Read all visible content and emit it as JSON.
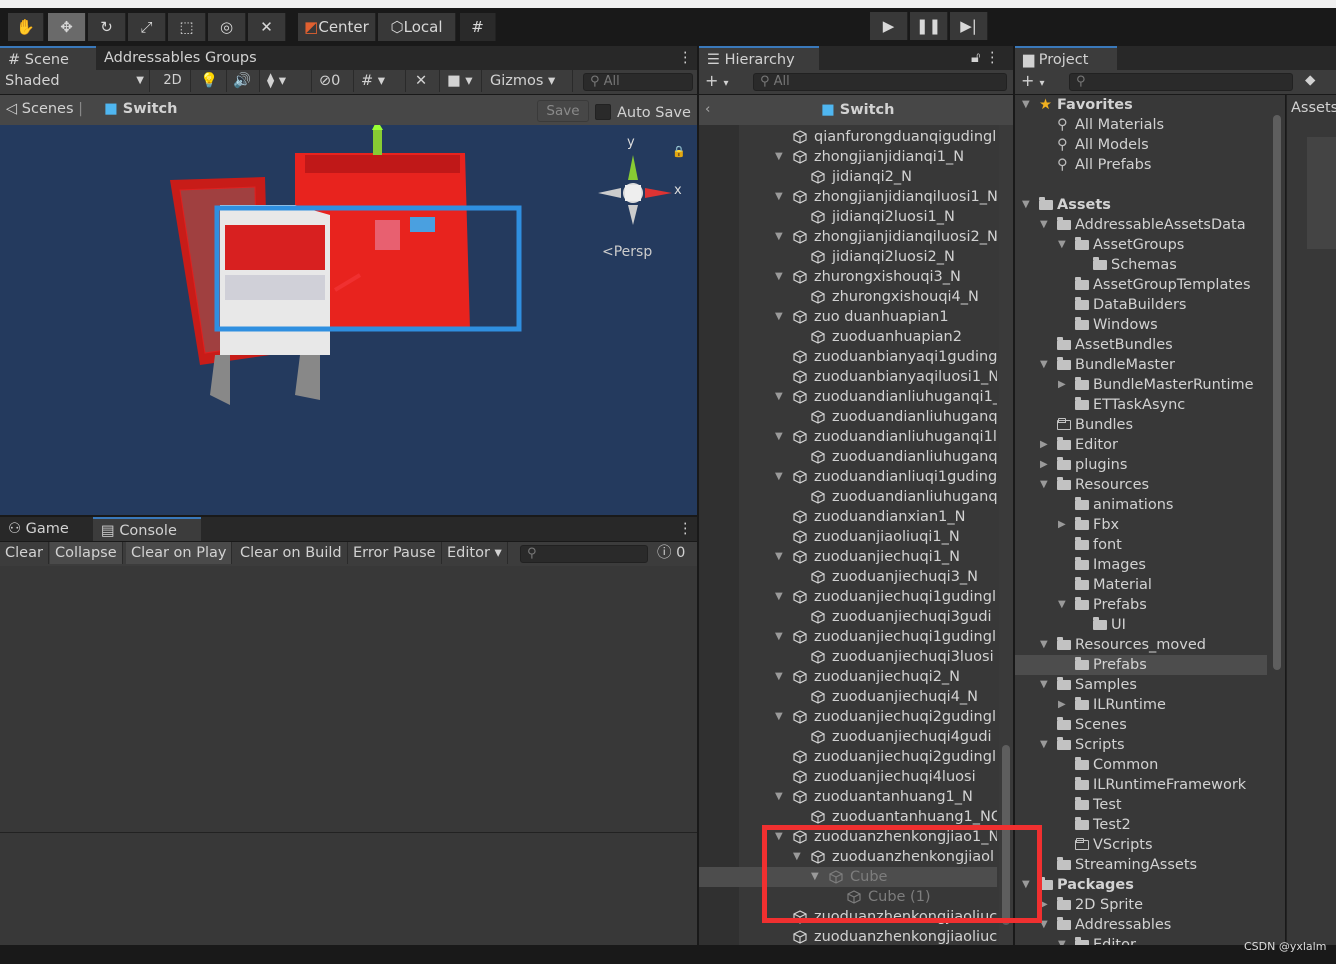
{
  "toolbar": {
    "center_label": "Center",
    "local_label": "Local",
    "tools": [
      "hand-tool",
      "move-tool",
      "rotate-tool",
      "scale-tool",
      "rect-tool",
      "transform-tool",
      "custom-tool"
    ]
  },
  "scene_panel": {
    "tabs": [
      "Scene",
      "Addressables Groups"
    ],
    "shading": "Shaded",
    "mode_2d": "2D",
    "hidden_count": "0",
    "gizmos": "Gizmos",
    "search_placeholder": "All",
    "breadcrumb_scenes": "Scenes",
    "breadcrumb_scene": "Switch",
    "save": "Save",
    "auto_save": "Auto Save",
    "persp": "Persp",
    "axis_y": "y",
    "axis_x": "x"
  },
  "console_panel": {
    "tabs": [
      "Game",
      "Console"
    ],
    "buttons": [
      "Clear",
      "Collapse",
      "Clear on Play",
      "Clear on Build",
      "Error Pause",
      "Editor"
    ],
    "error_count": "0"
  },
  "hierarchy": {
    "title": "Hierarchy",
    "search_placeholder": "All",
    "scene": "Switch",
    "items": [
      {
        "n": "qianfurongduanqigudingl",
        "l": 0,
        "a": ""
      },
      {
        "n": "zhongjianjidianqi1_N",
        "l": 0,
        "a": "v"
      },
      {
        "n": "jidianqi2_N",
        "l": 1,
        "a": ""
      },
      {
        "n": "zhongjianjidianqiluosi1_N",
        "l": 0,
        "a": "v"
      },
      {
        "n": "jidianqi2luosi1_N",
        "l": 1,
        "a": ""
      },
      {
        "n": "zhongjianjidianqiluosi2_N",
        "l": 0,
        "a": "v"
      },
      {
        "n": "jidianqi2luosi2_N",
        "l": 1,
        "a": ""
      },
      {
        "n": "zhurongxishouqi3_N",
        "l": 0,
        "a": "v"
      },
      {
        "n": "zhurongxishouqi4_N",
        "l": 1,
        "a": ""
      },
      {
        "n": "zuo duanhuapian1",
        "l": 0,
        "a": "v"
      },
      {
        "n": "zuoduanhuapian2",
        "l": 1,
        "a": ""
      },
      {
        "n": "zuoduanbianyaqi1guding",
        "l": 0,
        "a": ""
      },
      {
        "n": "zuoduanbianyaqiluosi1_N",
        "l": 0,
        "a": ""
      },
      {
        "n": "zuoduandianliuhuganqi1_",
        "l": 0,
        "a": "v"
      },
      {
        "n": "zuoduandianliuhuganq",
        "l": 1,
        "a": ""
      },
      {
        "n": "zuoduandianliuhuganqi1l",
        "l": 0,
        "a": "v"
      },
      {
        "n": "zuoduandianliuhuganq",
        "l": 1,
        "a": ""
      },
      {
        "n": "zuoduandianliuqi1guding",
        "l": 0,
        "a": "v"
      },
      {
        "n": "zuoduandianliuhuganq",
        "l": 1,
        "a": ""
      },
      {
        "n": "zuoduandianxian1_N",
        "l": 0,
        "a": ""
      },
      {
        "n": "zuoduanjiaoliuqi1_N",
        "l": 0,
        "a": ""
      },
      {
        "n": "zuoduanjiechuqi1_N",
        "l": 0,
        "a": "v"
      },
      {
        "n": "zuoduanjiechuqi3_N",
        "l": 1,
        "a": ""
      },
      {
        "n": "zuoduanjiechuqi1gudingl",
        "l": 0,
        "a": "v"
      },
      {
        "n": "zuoduanjiechuqi3gudi",
        "l": 1,
        "a": ""
      },
      {
        "n": "zuoduanjiechuqi1gudingl",
        "l": 0,
        "a": "v"
      },
      {
        "n": "zuoduanjiechuqi3luosi",
        "l": 1,
        "a": ""
      },
      {
        "n": "zuoduanjiechuqi2_N",
        "l": 0,
        "a": "v"
      },
      {
        "n": "zuoduanjiechuqi4_N",
        "l": 1,
        "a": ""
      },
      {
        "n": "zuoduanjiechuqi2gudingl",
        "l": 0,
        "a": "v"
      },
      {
        "n": "zuoduanjiechuqi4gudi",
        "l": 1,
        "a": ""
      },
      {
        "n": "zuoduanjiechuqi2gudingl",
        "l": 0,
        "a": ""
      },
      {
        "n": "zuoduanjiechuqi4luosi",
        "l": 0,
        "a": ""
      },
      {
        "n": "zuoduantanhuang1_N",
        "l": 0,
        "a": "v"
      },
      {
        "n": "zuoduantanhuang1_NC",
        "l": 1,
        "a": ""
      },
      {
        "n": "zuoduanzhenkongjiao1_N",
        "l": 0,
        "a": "v"
      },
      {
        "n": "zuoduanzhenkongjiaol",
        "l": 1,
        "a": "v"
      },
      {
        "n": "Cube",
        "l": 2,
        "a": "v",
        "dim": true,
        "sel": true
      },
      {
        "n": "Cube (1)",
        "l": 3,
        "a": "",
        "dim": true
      },
      {
        "n": "zuoduanzhenkongjiaoliuc",
        "l": 0,
        "a": ""
      },
      {
        "n": "zuoduanzhenkongjiaoliuc",
        "l": 0,
        "a": ""
      }
    ]
  },
  "project": {
    "title": "Project",
    "assets_label": "Assets",
    "items": [
      {
        "n": "Favorites",
        "l": 0,
        "a": "v",
        "i": "star",
        "b": true
      },
      {
        "n": "All Materials",
        "l": 1,
        "a": "",
        "i": "search"
      },
      {
        "n": "All Models",
        "l": 1,
        "a": "",
        "i": "search"
      },
      {
        "n": "All Prefabs",
        "l": 1,
        "a": "",
        "i": "search"
      },
      {
        "n": "",
        "l": 0,
        "a": "",
        "i": ""
      },
      {
        "n": "Assets",
        "l": 0,
        "a": "v",
        "i": "folder",
        "b": true
      },
      {
        "n": "AddressableAssetsData",
        "l": 1,
        "a": "v",
        "i": "folder"
      },
      {
        "n": "AssetGroups",
        "l": 2,
        "a": "v",
        "i": "folder"
      },
      {
        "n": "Schemas",
        "l": 3,
        "a": "",
        "i": "folder"
      },
      {
        "n": "AssetGroupTemplates",
        "l": 2,
        "a": "",
        "i": "folder"
      },
      {
        "n": "DataBuilders",
        "l": 2,
        "a": "",
        "i": "folder"
      },
      {
        "n": "Windows",
        "l": 2,
        "a": "",
        "i": "folder"
      },
      {
        "n": "AssetBundles",
        "l": 1,
        "a": "",
        "i": "folder"
      },
      {
        "n": "BundleMaster",
        "l": 1,
        "a": "v",
        "i": "folder"
      },
      {
        "n": "BundleMasterRuntime",
        "l": 2,
        "a": ">",
        "i": "folder"
      },
      {
        "n": "ETTaskAsync",
        "l": 2,
        "a": "",
        "i": "folder"
      },
      {
        "n": "Bundles",
        "l": 1,
        "a": "",
        "i": "empty"
      },
      {
        "n": "Editor",
        "l": 1,
        "a": ">",
        "i": "folder"
      },
      {
        "n": "plugins",
        "l": 1,
        "a": ">",
        "i": "folder"
      },
      {
        "n": "Resources",
        "l": 1,
        "a": "v",
        "i": "folder"
      },
      {
        "n": "animations",
        "l": 2,
        "a": "",
        "i": "folder"
      },
      {
        "n": "Fbx",
        "l": 2,
        "a": ">",
        "i": "folder"
      },
      {
        "n": "font",
        "l": 2,
        "a": "",
        "i": "folder"
      },
      {
        "n": "Images",
        "l": 2,
        "a": "",
        "i": "folder"
      },
      {
        "n": "Material",
        "l": 2,
        "a": "",
        "i": "folder"
      },
      {
        "n": "Prefabs",
        "l": 2,
        "a": "v",
        "i": "folder"
      },
      {
        "n": "UI",
        "l": 3,
        "a": "",
        "i": "folder"
      },
      {
        "n": "Resources_moved",
        "l": 1,
        "a": "v",
        "i": "folder"
      },
      {
        "n": "Prefabs",
        "l": 2,
        "a": "",
        "i": "folder",
        "sel": true
      },
      {
        "n": "Samples",
        "l": 1,
        "a": "v",
        "i": "folder"
      },
      {
        "n": "ILRuntime",
        "l": 2,
        "a": ">",
        "i": "folder"
      },
      {
        "n": "Scenes",
        "l": 1,
        "a": "",
        "i": "folder"
      },
      {
        "n": "Scripts",
        "l": 1,
        "a": "v",
        "i": "folder"
      },
      {
        "n": "Common",
        "l": 2,
        "a": "",
        "i": "folder"
      },
      {
        "n": "ILRuntimeFramework",
        "l": 2,
        "a": "",
        "i": "folder"
      },
      {
        "n": "Test",
        "l": 2,
        "a": "",
        "i": "folder"
      },
      {
        "n": "Test2",
        "l": 2,
        "a": "",
        "i": "folder"
      },
      {
        "n": "VScripts",
        "l": 2,
        "a": "",
        "i": "empty"
      },
      {
        "n": "StreamingAssets",
        "l": 1,
        "a": "",
        "i": "folder"
      },
      {
        "n": "Packages",
        "l": 0,
        "a": "v",
        "i": "folder",
        "b": true
      },
      {
        "n": "2D Sprite",
        "l": 1,
        "a": ">",
        "i": "folder"
      },
      {
        "n": "Addressables",
        "l": 1,
        "a": "v",
        "i": "folder"
      },
      {
        "n": "Editor",
        "l": 2,
        "a": "v",
        "i": "folder"
      }
    ]
  },
  "watermark": "CSDN @yxlalm",
  "colors": {
    "scene_bg": "#243a5e",
    "model_red": "#e8231e",
    "selection_blue": "#2f8fe0",
    "highlight_red": "#f03030"
  }
}
